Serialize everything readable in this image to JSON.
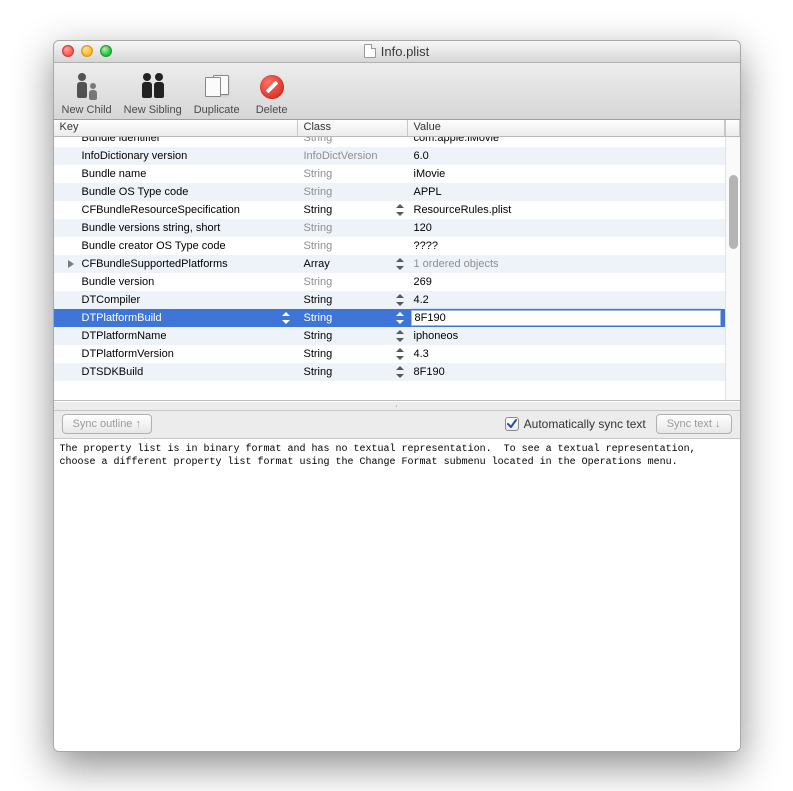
{
  "window": {
    "title": "Info.plist"
  },
  "toolbar": {
    "new_child": "New Child",
    "new_sibling": "New Sibling",
    "duplicate": "Duplicate",
    "delete": "Delete"
  },
  "columns": {
    "key": "Key",
    "class": "Class",
    "value": "Value"
  },
  "rows": [
    {
      "key": "Bundle identifier",
      "class": "String",
      "class_muted": true,
      "value": "com.apple.iMovie",
      "stepper": false,
      "alt": false,
      "clipped_top": true
    },
    {
      "key": "InfoDictionary version",
      "class": "InfoDictVersion",
      "class_muted": true,
      "value": "6.0",
      "stepper": false,
      "alt": true
    },
    {
      "key": "Bundle name",
      "class": "String",
      "class_muted": true,
      "value": "iMovie",
      "stepper": false,
      "alt": false
    },
    {
      "key": "Bundle OS Type code",
      "class": "String",
      "class_muted": true,
      "value": "APPL",
      "stepper": false,
      "alt": true
    },
    {
      "key": "CFBundleResourceSpecification",
      "class": "String",
      "class_muted": false,
      "value": "ResourceRules.plist",
      "stepper": true,
      "alt": false
    },
    {
      "key": "Bundle versions string, short",
      "class": "String",
      "class_muted": true,
      "value": "120",
      "stepper": false,
      "alt": true
    },
    {
      "key": "Bundle creator OS Type code",
      "class": "String",
      "class_muted": true,
      "value": "????",
      "stepper": false,
      "alt": false
    },
    {
      "key": "CFBundleSupportedPlatforms",
      "class": "Array",
      "class_muted": false,
      "value": "1 ordered objects",
      "value_muted": true,
      "stepper": true,
      "alt": true,
      "disclosure": true
    },
    {
      "key": "Bundle version",
      "class": "String",
      "class_muted": true,
      "value": "269",
      "stepper": false,
      "alt": false
    },
    {
      "key": "DTCompiler",
      "class": "String",
      "class_muted": false,
      "value": "4.2",
      "stepper": true,
      "alt": true
    },
    {
      "key": "DTPlatformBuild",
      "class": "String",
      "class_muted": false,
      "value": "8F190",
      "stepper": true,
      "alt": false,
      "selected": true,
      "editing_value": true
    },
    {
      "key": "DTPlatformName",
      "class": "String",
      "class_muted": false,
      "value": "iphoneos",
      "stepper": true,
      "alt": true
    },
    {
      "key": "DTPlatformVersion",
      "class": "String",
      "class_muted": false,
      "value": "4.3",
      "stepper": true,
      "alt": false
    },
    {
      "key": "DTSDKBuild",
      "class": "String",
      "class_muted": false,
      "value": "8F190",
      "stepper": true,
      "alt": true
    }
  ],
  "sync": {
    "outline_btn": "Sync outline ↑",
    "auto_label": "Automatically sync text",
    "auto_checked": true,
    "text_btn": "Sync text ↓"
  },
  "text_pane": "The property list is in binary format and has no textual representation.  To see a textual representation, choose a different property list format using the Change Format submenu located in the Operations menu."
}
